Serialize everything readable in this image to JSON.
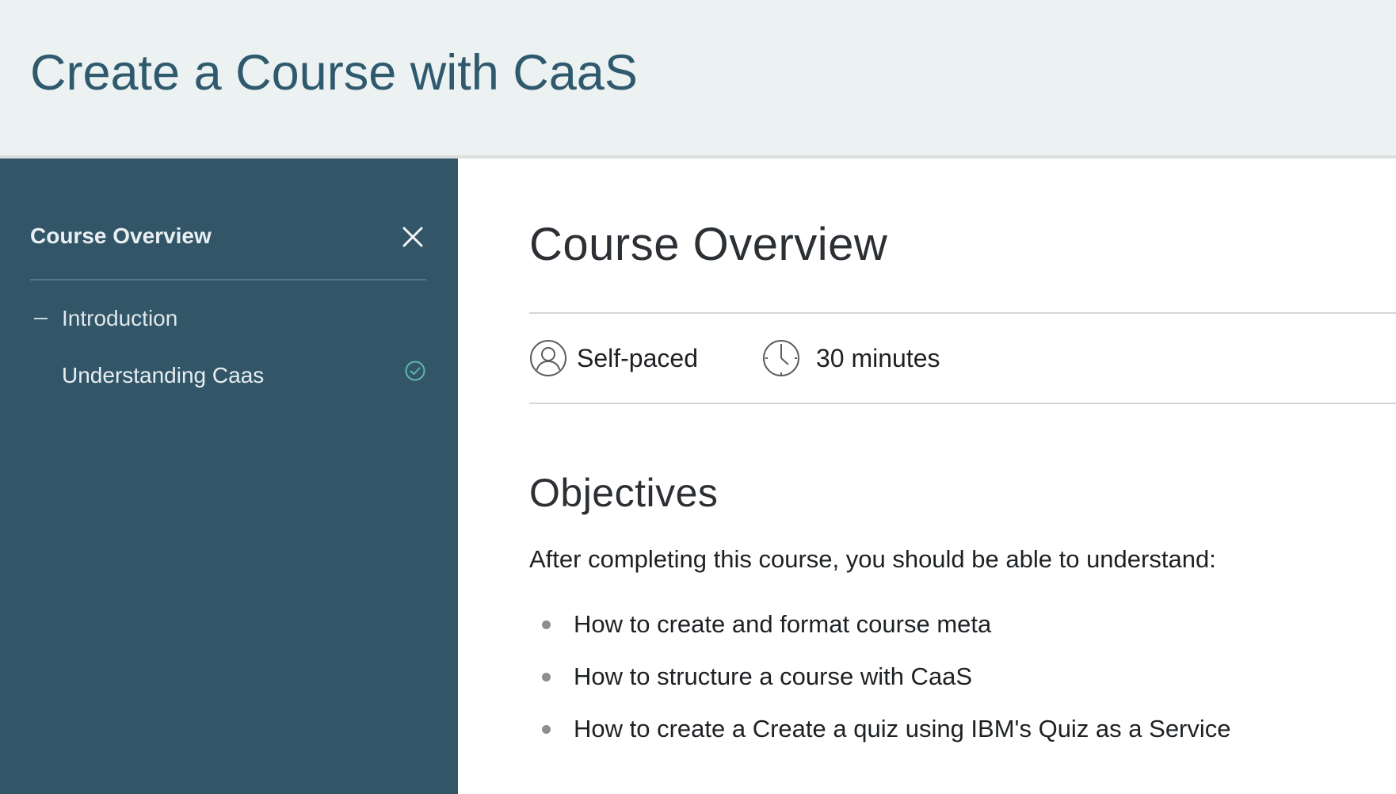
{
  "header": {
    "title": "Create a Course with CaaS"
  },
  "sidebar": {
    "heading": "Course Overview",
    "sections": [
      {
        "label": "Introduction",
        "expanded": true,
        "lessons": [
          {
            "label": "Understanding Caas",
            "completed": true
          }
        ]
      }
    ]
  },
  "main": {
    "title": "Course Overview",
    "meta": {
      "pace": "Self-paced",
      "duration": "30 minutes"
    },
    "objectives": {
      "heading": "Objectives",
      "intro": "After completing this course, you should be able to understand:",
      "items": [
        "How to create and format course meta",
        "How to structure a course with CaaS",
        "How to create a Create a quiz using IBM's Quiz as a Service"
      ]
    }
  },
  "colors": {
    "header_bg": "#ecf1f1",
    "header_title": "#2f5a6e",
    "sidebar_bg": "#325668",
    "check_accent": "#5fb4b0"
  }
}
